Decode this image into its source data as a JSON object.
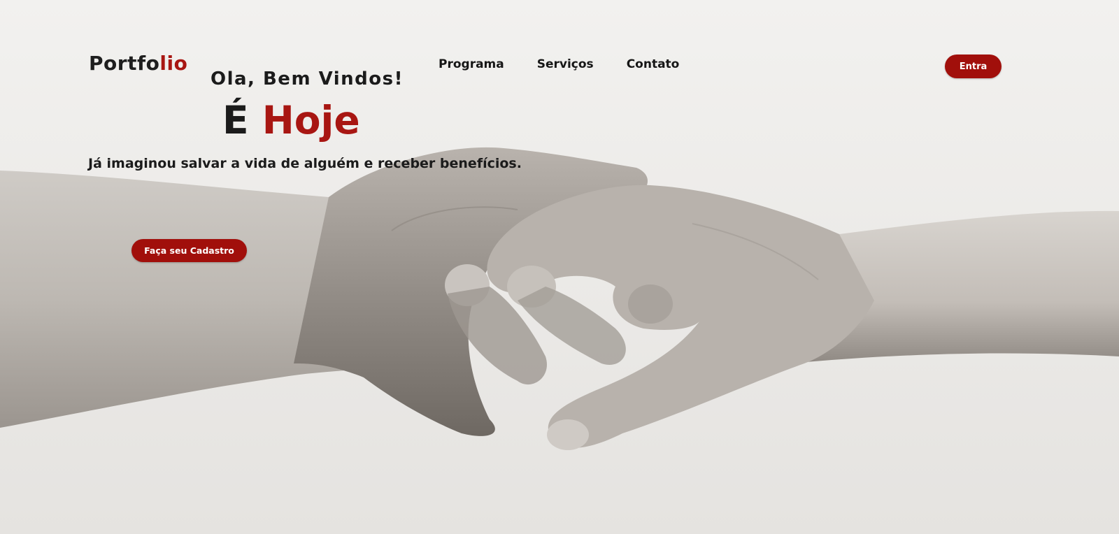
{
  "header": {
    "logo_prefix": "Portfo",
    "logo_suffix": "lio",
    "nav": [
      "Programa",
      "Serviços",
      "Contato"
    ],
    "login_label": "Entra"
  },
  "hero": {
    "greeting": "Ola, Bem Vindos!",
    "headline_part1": "É",
    "headline_part2": "Hoje",
    "subtitle": "Já imaginou salvar a vida de alguém e receber benefícios.",
    "cta_label": "Faça seu Cadastro",
    "image": "black-and-white photo of two hands clasped together"
  },
  "colors": {
    "accent": "#a10f0b",
    "text": "#1b1b1b",
    "background": "#efeeec"
  }
}
